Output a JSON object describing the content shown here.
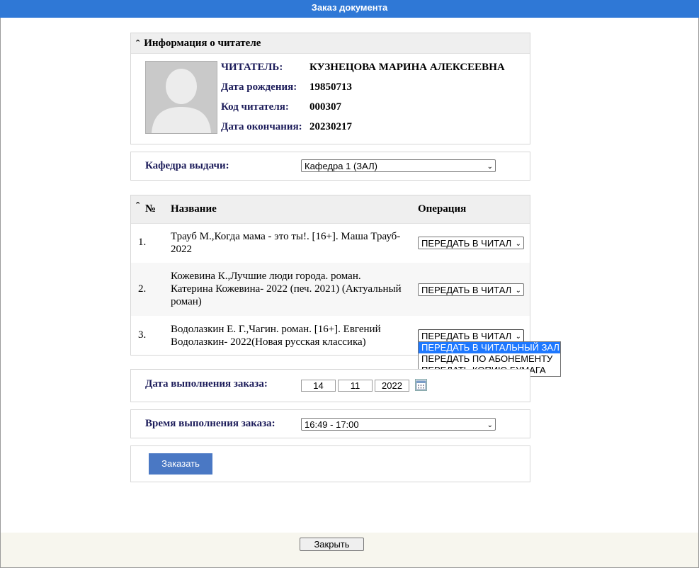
{
  "window": {
    "title": "Заказ документа"
  },
  "reader_panel": {
    "header": "Информация о читателе",
    "reader_label": "ЧИТАТЕЛЬ:",
    "reader_name": "КУЗНЕЦОВА МАРИНА АЛЕКСЕЕВНА",
    "birth_label": "Дата рождения:",
    "birth_value": "19850713",
    "code_label": "Код читателя:",
    "code_value": "000307",
    "end_label": "Дата окончания:",
    "end_value": "20230217"
  },
  "department": {
    "label": "Кафедра выдачи:",
    "selected": "Кафедра 1 (ЗАЛ)"
  },
  "orders_table": {
    "headers": {
      "num": "№",
      "title": "Название",
      "operation": "Операция"
    },
    "rows": [
      {
        "num": "1.",
        "title": "Трауб М.,Когда мама - это ты!. [16+]. Маша Трауб- 2022",
        "operation": "ПЕРЕДАТЬ В ЧИТАЛ"
      },
      {
        "num": "2.",
        "title": "Кожевина К.,Лучшие люди города. роман. Катерина Кожевина- 2022 (печ. 2021) (Актуальный роман)",
        "operation": "ПЕРЕДАТЬ В ЧИТАЛ"
      },
      {
        "num": "3.",
        "title": "Водолазкин Е. Г.,Чагин. роман. [16+]. Евгений Водолазкин- 2022(Новая русская классика)",
        "operation": "ПЕРЕДАТЬ В ЧИТАЛ"
      }
    ],
    "operation_options": [
      "ПЕРЕДАТЬ В ЧИТАЛЬНЫЙ ЗАЛ",
      "ПЕРЕДАТЬ ПО АБОНЕМЕНТУ",
      "ПЕРЕДАТЬ КОПИЮ БУМАГА"
    ]
  },
  "order_date": {
    "label": "Дата выполнения заказа:",
    "day": "14",
    "month": "11",
    "year": "2022"
  },
  "order_time": {
    "label": "Время выполнения заказа:",
    "selected": "16:49 - 17:00"
  },
  "buttons": {
    "order": "Заказать",
    "close": "Закрыть"
  },
  "colors": {
    "titlebar": "#2f78d6",
    "order_button": "#4a78c4",
    "label_text": "#1c1c5a",
    "highlight": "#1e78ff"
  }
}
